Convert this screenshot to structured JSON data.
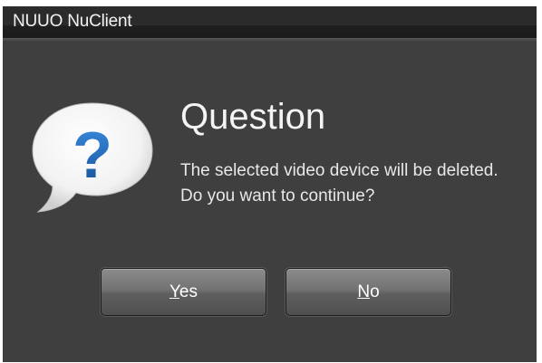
{
  "window": {
    "title": "NUUO NuClient"
  },
  "dialog": {
    "icon": "question-bubble-icon",
    "heading": "Question",
    "message": "The selected video device will be deleted. Do you want to continue?"
  },
  "buttons": {
    "yes_mnemonic": "Y",
    "yes_rest": "es",
    "no_mnemonic": "N",
    "no_rest": "o"
  },
  "colors": {
    "dialog_background": "#403f3f",
    "title_bar": "#2b2b2b",
    "icon_accent": "#1f66b8",
    "button_face": "#727272"
  }
}
